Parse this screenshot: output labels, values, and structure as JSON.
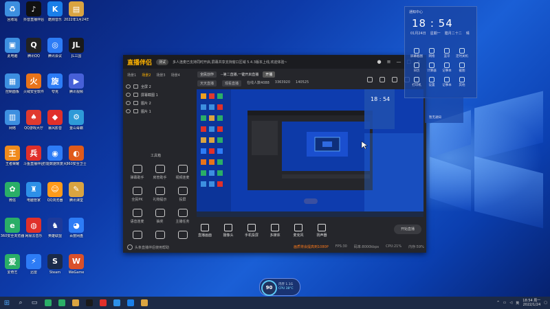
{
  "desktop": {
    "icons": [
      {
        "label": "回收站",
        "color": "#3d8fe0",
        "glyph": "♻"
      },
      {
        "label": "抖音直播伴侣",
        "color": "#111",
        "glyph": "♪"
      },
      {
        "label": "酷狗音乐",
        "color": "#1a7fe8",
        "glyph": "K"
      },
      {
        "label": "2022年1月24日",
        "color": "#d9a441",
        "glyph": "▤"
      },
      {
        "label": "此电脑",
        "color": "#3d8fe0",
        "glyph": "▣"
      },
      {
        "label": "腾讯QQ",
        "color": "#222",
        "glyph": "Q"
      },
      {
        "label": "腾讯会议",
        "color": "#2d7cf6",
        "glyph": "◎"
      },
      {
        "label": "JL三国",
        "color": "#1a1a1a",
        "glyph": "JL"
      },
      {
        "label": "控制面板",
        "color": "#3d8fe0",
        "glyph": "▦"
      },
      {
        "label": "火绒安全软件",
        "color": "#e8731a",
        "glyph": "火"
      },
      {
        "label": "夸克",
        "color": "#2c7cf6",
        "glyph": "旋"
      },
      {
        "label": "腾讯视频",
        "color": "#4760d8",
        "glyph": "▶"
      },
      {
        "label": "网络",
        "color": "#3d8fe0",
        "glyph": "▥"
      },
      {
        "label": "QQ游戏大厅",
        "color": "#e03a2f",
        "glyph": "♠"
      },
      {
        "label": "暴风影音",
        "color": "#e0302a",
        "glyph": "◆"
      },
      {
        "label": "金山毒霸",
        "color": "#2e9ad8",
        "glyph": "⚙"
      },
      {
        "label": "王者荣耀",
        "color": "#f08a1c",
        "glyph": "王"
      },
      {
        "label": "斗鱼直播伴侣",
        "color": "#e0302a",
        "glyph": "兵"
      },
      {
        "label": "万能数据恢复大师",
        "color": "#2d7cf6",
        "glyph": "◉"
      },
      {
        "label": "360安全卫士",
        "color": "#e05a1a",
        "glyph": "◐"
      },
      {
        "label": "微信",
        "color": "#2aae67",
        "glyph": "✿"
      },
      {
        "label": "电脑管家",
        "color": "#2d90e8",
        "glyph": "♜"
      },
      {
        "label": "QQ浏览器",
        "color": "#ff9b1a",
        "glyph": "☺"
      },
      {
        "label": "腾讯课堂",
        "color": "#d9a441",
        "glyph": "✎"
      },
      {
        "label": "360安全浏览器",
        "color": "#2aae67",
        "glyph": "e"
      },
      {
        "label": "网易云音乐",
        "color": "#e0302a",
        "glyph": "◍"
      },
      {
        "label": "英雄联盟",
        "color": "#1d3a9a",
        "glyph": "♞"
      },
      {
        "label": "百度网盘",
        "color": "#2d7cf6",
        "glyph": "◕"
      },
      {
        "label": "爱奇艺",
        "color": "#2aae67",
        "glyph": "爱"
      },
      {
        "label": "迅雷",
        "color": "#2d7cf6",
        "glyph": "⚡"
      },
      {
        "label": "Steam",
        "color": "#1a2a4a",
        "glyph": "S"
      },
      {
        "label": "WeGame",
        "color": "#d9502a",
        "glyph": "W"
      }
    ]
  },
  "app": {
    "logo_main": "直播伴侣",
    "logo_sub": "",
    "badge": "测试",
    "notice": "多人连麦已支持同时开启,屏幕共享支持窗口区域 5.4.3版本上线,欢迎体验~",
    "scene_tabs": [
      "场景1",
      "场景2",
      "场景3",
      "场景4"
    ],
    "active_tab_index": 1,
    "layers": [
      "全屏 2",
      "屏幕截图 1",
      "图片 2",
      "图片 1"
    ],
    "tools_title": "工具箱",
    "tools": [
      "弹幕助手",
      "房管助手",
      "视频连麦",
      "全民PK",
      "礼物提示",
      "投屏",
      "语音连麦",
      "抽奖",
      "主播任务",
      "",
      "",
      ""
    ],
    "hint": "头条直播伴侣使用帮助",
    "ctrl": {
      "quality": "全民创作",
      "mode": "--第二直播,一键开启直播",
      "pc_btn": "开播",
      "extra": "设置"
    },
    "stats": {
      "viewers": "天天直播",
      "recv": "观看直播",
      "id": "在线人数4088",
      "fans": "3363920",
      "likes": "140525"
    },
    "bottom_tools": [
      "直播画面",
      "摄像头",
      "手机投屏",
      "多媒体",
      "麦克风",
      "扬声器"
    ],
    "start_live": "开始直播",
    "statusbar": {
      "warn": "画质将会提高到1080P",
      "fps": "FPS:30",
      "bitrate": "码率:8000kbps",
      "cpu": "CPU:21%",
      "mem": "内存:59%"
    }
  },
  "calendar": {
    "header": "通知中心",
    "time": "18 : 54",
    "date": "01月24日",
    "weekday": "星期一",
    "lunar": "腊月二十二",
    "weather": "晴",
    "grid": [
      "屏幕截图",
      "网络",
      "蓝牙",
      "定时关机",
      "日历",
      "计算器",
      "记事本",
      "截图",
      "打印机",
      "设置",
      "记事本",
      "其他"
    ],
    "footer": "暂无通知"
  },
  "monitor": {
    "percent": "90",
    "m1": "内存 1.1G",
    "m2": "CPU 38°C"
  },
  "taskbar": {
    "items": [
      {
        "name": "windows-start",
        "color": "#4ea3f5"
      },
      {
        "name": "search",
        "color": "#cfd8e6"
      },
      {
        "name": "task-view",
        "color": "#cfd8e6"
      },
      {
        "name": "app-1",
        "color": "#2aae67"
      },
      {
        "name": "app-2",
        "color": "#2aae67"
      },
      {
        "name": "app-3",
        "color": "#d9a441"
      },
      {
        "name": "app-4",
        "color": "#1a1a1a"
      },
      {
        "name": "app-5",
        "color": "#e0302a"
      },
      {
        "name": "app-6",
        "color": "#2d90e8"
      },
      {
        "name": "app-7",
        "color": "#1a7fe8"
      },
      {
        "name": "app-8",
        "color": "#d9a441"
      }
    ],
    "lang": "英",
    "clock_time": "18:54 周一",
    "clock_date": "2022/1/24"
  }
}
